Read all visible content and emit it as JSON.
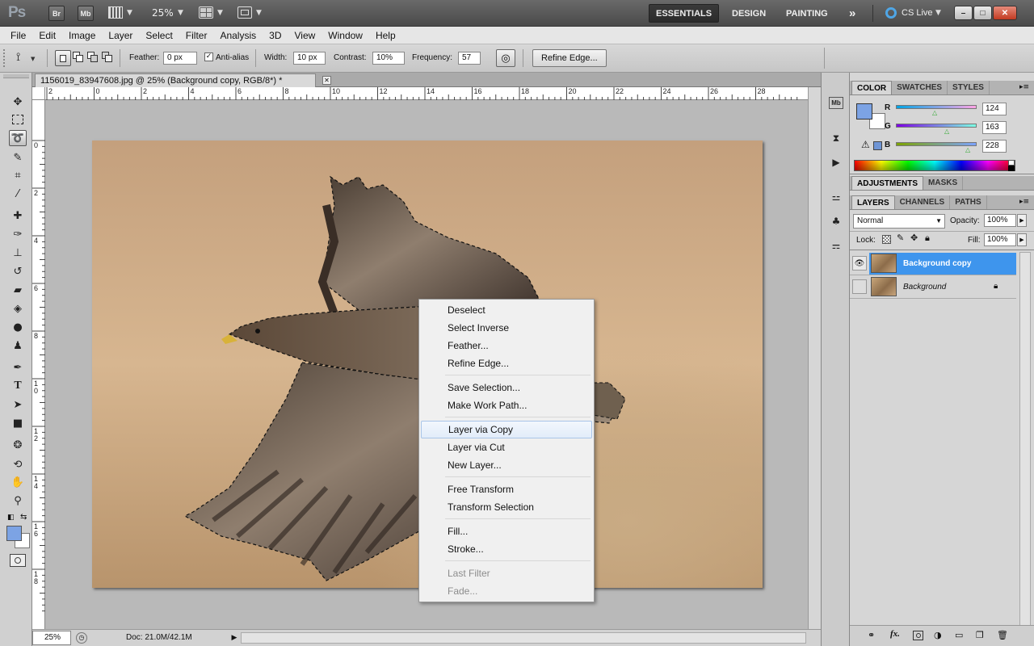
{
  "app": {
    "logo": "Ps",
    "bridge_label": "Br",
    "minibridge_label": "Mb",
    "zoom": "25%",
    "cslive_label": "CS Live",
    "win_min": "–",
    "win_restore": "□",
    "win_close": "✕"
  },
  "workspaces": [
    {
      "label": "ESSENTIALS",
      "active": true
    },
    {
      "label": "DESIGN"
    },
    {
      "label": "PAINTING"
    }
  ],
  "more_glyph": "»",
  "menu": [
    "File",
    "Edit",
    "Image",
    "Layer",
    "Select",
    "Filter",
    "Analysis",
    "3D",
    "View",
    "Window",
    "Help"
  ],
  "options": {
    "feather_label": "Feather:",
    "feather_value": "0 px",
    "antialias_label": "Anti-alias",
    "width_label": "Width:",
    "width_value": "10 px",
    "contrast_label": "Contrast:",
    "contrast_value": "10%",
    "frequency_label": "Frequency:",
    "frequency_value": "57",
    "refine_label": "Refine Edge..."
  },
  "document": {
    "tab_title": "1156019_83947608.jpg @ 25% (Background copy, RGB/8*) *"
  },
  "rulers": {
    "h": [
      "2",
      "0",
      "2",
      "4",
      "6",
      "8",
      "10",
      "12",
      "14",
      "16",
      "18",
      "20",
      "22",
      "24",
      "26",
      "28"
    ],
    "v": [
      "0",
      "2",
      "4",
      "6",
      "8",
      "1\n0",
      "1\n2",
      "1\n4",
      "1\n6",
      "1\n8"
    ]
  },
  "context_menu": {
    "groups": [
      [
        {
          "label": "Deselect"
        },
        {
          "label": "Select Inverse"
        },
        {
          "label": "Feather..."
        },
        {
          "label": "Refine Edge..."
        }
      ],
      [
        {
          "label": "Save Selection..."
        },
        {
          "label": "Make Work Path..."
        }
      ],
      [
        {
          "label": "Layer via Copy",
          "highlighted": true
        },
        {
          "label": "Layer via Cut"
        },
        {
          "label": "New Layer..."
        }
      ],
      [
        {
          "label": "Free Transform"
        },
        {
          "label": "Transform Selection"
        }
      ],
      [
        {
          "label": "Fill..."
        },
        {
          "label": "Stroke..."
        }
      ],
      [
        {
          "label": "Last Filter",
          "disabled": true
        },
        {
          "label": "Fade...",
          "disabled": true
        }
      ]
    ]
  },
  "status": {
    "zoom": "25%",
    "doc": "Doc: 21.0M/42.1M"
  },
  "color_panel": {
    "tabs": [
      "COLOR",
      "SWATCHES",
      "STYLES"
    ],
    "r_label": "R",
    "g_label": "G",
    "b_label": "B",
    "r": "124",
    "g": "163",
    "b": "228",
    "foreground": "#7ca3e4"
  },
  "adjustments_panel": {
    "tabs": [
      "ADJUSTMENTS",
      "MASKS"
    ]
  },
  "layers_panel": {
    "tabs": [
      "LAYERS",
      "CHANNELS",
      "PATHS"
    ],
    "blend_mode": "Normal",
    "opacity_label": "Opacity:",
    "opacity_value": "100%",
    "lock_label": "Lock:",
    "fill_label": "Fill:",
    "fill_value": "100%",
    "layers": [
      {
        "name": "Background copy",
        "selected": true,
        "visible": true
      },
      {
        "name": "Background",
        "selected": false,
        "visible": false,
        "locked": true
      }
    ]
  },
  "colors": {
    "accent": "#4d9ff0",
    "selected_layer": "#3e95ed"
  }
}
